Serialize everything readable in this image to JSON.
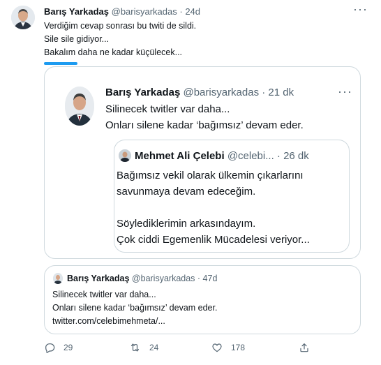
{
  "main": {
    "author": {
      "name": "Barış Yarkadaş",
      "handle": "@barisyarkadas",
      "time": "· 24d"
    },
    "lines": [
      "Verdiğim cevap sonrası bu twiti de sildi.",
      "Sile sile gidiyor...",
      "Bakalım daha ne kadar küçülecek..."
    ]
  },
  "quote": {
    "author": {
      "name": "Barış Yarkadaş",
      "handle": "@barisyarkadas",
      "time": "· 21 dk"
    },
    "lines": [
      "Silinecek twitler var daha...",
      "Onları silene kadar ‘bağımsız’ devam eder."
    ],
    "inner": {
      "author": {
        "name": "Mehmet Ali Çelebi",
        "handle": "@celebi...",
        "time": "· 26 dk"
      },
      "lines": [
        "Bağımsız vekil olarak ülkemin çıkarlarını",
        "savunmaya devam edeceğim.",
        "Söylediklerimin arkasındayım.",
        "Çok ciddi Egemenlik Mücadelesi veriyor..."
      ]
    }
  },
  "quote2": {
    "author": {
      "name": "Barış Yarkadaş",
      "handle": "@barisyarkadas",
      "time": "· 47d"
    },
    "lines": [
      "Silinecek twitler var daha...",
      "Onları silene kadar ‘bağımsız’ devam eder.",
      "twitter.com/celebimehmeta/..."
    ]
  },
  "actions": {
    "replies": "29",
    "retweets": "24",
    "likes": "178"
  },
  "colors": {
    "accent": "#1d9bf0",
    "secondary": "#536471",
    "border": "#cfd9de"
  },
  "icons": [
    "more-icon",
    "reply-icon",
    "retweet-icon",
    "like-icon",
    "share-icon"
  ]
}
